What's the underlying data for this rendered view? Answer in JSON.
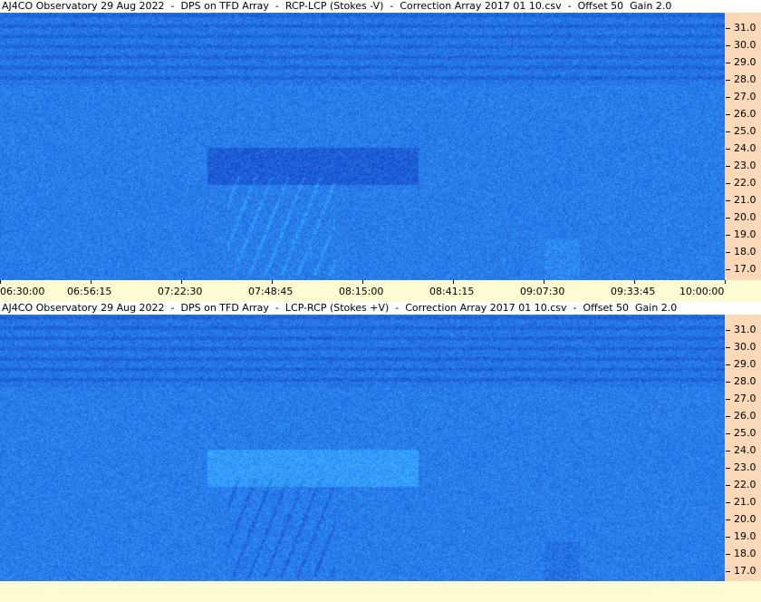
{
  "panels": [
    {
      "title": "AJ4CO Observatory 29 Aug 2022  -  DPS on TFD Array  -  RCP-LCP (Stokes -V)  -  Correction Array 2017 01 10.csv  -  Offset 50  Gain 2.0",
      "mode": "stokes_minus_v"
    },
    {
      "title": "AJ4CO Observatory 29 Aug 2022  -  DPS on TFD Array  -  LCP-RCP (Stokes +V)  -  Correction Array 2017 01 10.csv  -  Offset 50  Gain 2.0",
      "mode": "stokes_plus_v"
    }
  ],
  "freq_ticks": [
    "31.0",
    "30.0",
    "29.0",
    "28.0",
    "27.0",
    "26.0",
    "25.0",
    "24.0",
    "23.0",
    "22.0",
    "21.0",
    "20.0",
    "19.0",
    "18.0",
    "17.0"
  ],
  "time_ticks": [
    "06:30:00",
    "06:56:15",
    "07:22:30",
    "07:48:45",
    "08:15:00",
    "08:41:15",
    "09:07:30",
    "09:33:45",
    "10:00:00"
  ],
  "colors": {
    "background_blue": "#1a62f0",
    "freq_axis_bg": "#fad8b8",
    "time_axis_bg": "#fffbd2"
  }
}
